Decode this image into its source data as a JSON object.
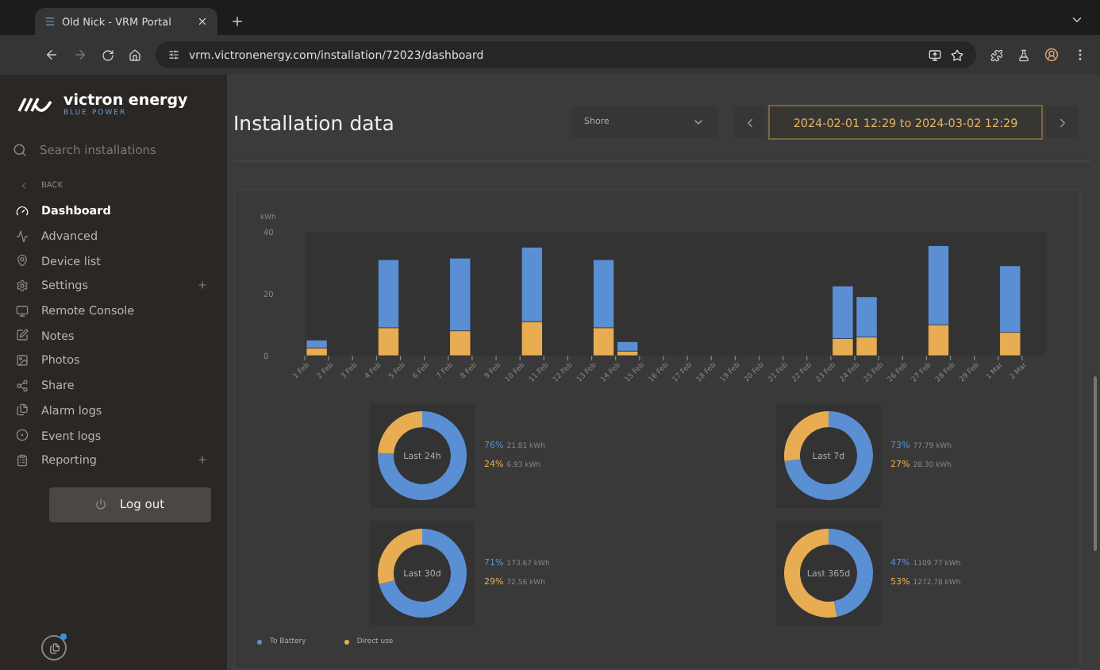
{
  "browser": {
    "tab_title": "Old Nick - VRM Portal",
    "url": "vrm.victronenergy.com/installation/72023/dashboard"
  },
  "sidebar": {
    "brand": "victron energy",
    "brand_tagline": "BLUE POWER",
    "search": {
      "placeholder": "Search installations"
    },
    "back": "BACK",
    "items": [
      {
        "label": "Dashboard",
        "selected": true,
        "expandable": false
      },
      {
        "label": "Advanced",
        "selected": false,
        "expandable": false
      },
      {
        "label": "Device list",
        "selected": false,
        "expandable": false
      },
      {
        "label": "Settings",
        "selected": false,
        "expandable": true
      },
      {
        "label": "Remote Console",
        "selected": false,
        "expandable": false
      },
      {
        "label": "Notes",
        "selected": false,
        "expandable": false
      },
      {
        "label": "Photos",
        "selected": false,
        "expandable": false
      },
      {
        "label": "Share",
        "selected": false,
        "expandable": false
      },
      {
        "label": "Alarm logs",
        "selected": false,
        "expandable": false
      },
      {
        "label": "Event logs",
        "selected": false,
        "expandable": false
      },
      {
        "label": "Reporting",
        "selected": false,
        "expandable": true
      }
    ],
    "logout": "Log out"
  },
  "header": {
    "title": "Installation data",
    "source": "Shore",
    "range": "2024-02-01 12:29 to 2024-03-02 12:29"
  },
  "chart_data": {
    "type": "bar",
    "stacked": true,
    "ylabel": "kWh",
    "ylim": [
      0,
      40
    ],
    "yticks": [
      0,
      20,
      40
    ],
    "categories": [
      "1 Feb",
      "2 Feb",
      "3 Feb",
      "4 Feb",
      "5 Feb",
      "6 Feb",
      "7 Feb",
      "8 Feb",
      "9 Feb",
      "10 Feb",
      "11 Feb",
      "12 Feb",
      "13 Feb",
      "14 Feb",
      "15 Feb",
      "16 Feb",
      "17 Feb",
      "18 Feb",
      "19 Feb",
      "20 Feb",
      "21 Feb",
      "22 Feb",
      "23 Feb",
      "24 Feb",
      "25 Feb",
      "26 Feb",
      "27 Feb",
      "28 Feb",
      "29 Feb",
      "1 Mar",
      "2 Mar"
    ],
    "series": [
      {
        "name": "To Battery",
        "color": "#5b8fd3",
        "values": [
          2.5,
          0,
          0,
          22,
          0,
          0,
          23.5,
          0,
          0,
          24,
          0,
          0,
          22,
          3,
          0,
          0,
          0,
          0,
          0,
          0,
          0,
          0,
          17,
          13,
          0,
          0,
          25.5,
          0,
          0,
          21.5,
          0
        ]
      },
      {
        "name": "Direct use",
        "color": "#e8ad52",
        "values": [
          2.5,
          0,
          0,
          9,
          0,
          0,
          8,
          0,
          0,
          11,
          0,
          0,
          9,
          1.5,
          0,
          0,
          0,
          0,
          0,
          0,
          0,
          0,
          5.5,
          6,
          0,
          0,
          10,
          0,
          0,
          7.5,
          0
        ]
      }
    ]
  },
  "donuts": [
    {
      "chart_data": {
        "type": "donut",
        "title": "Last 24h",
        "values": [
          76,
          24
        ]
      },
      "readings": [
        {
          "percent": "76%",
          "energy": "21.81 kWh"
        },
        {
          "percent": "24%",
          "energy": "6.93 kWh"
        }
      ]
    },
    {
      "chart_data": {
        "type": "donut",
        "title": "Last 7d",
        "values": [
          73,
          27
        ]
      },
      "readings": [
        {
          "percent": "73%",
          "energy": "77.79 kWh"
        },
        {
          "percent": "27%",
          "energy": "28.30 kWh"
        }
      ]
    },
    {
      "chart_data": {
        "type": "donut",
        "title": "Last 30d",
        "values": [
          71,
          29
        ]
      },
      "readings": [
        {
          "percent": "71%",
          "energy": "173.67 kWh"
        },
        {
          "percent": "29%",
          "energy": "72.56 kWh"
        }
      ]
    },
    {
      "chart_data": {
        "type": "donut",
        "title": "Last 365d",
        "values": [
          47,
          53
        ]
      },
      "readings": [
        {
          "percent": "47%",
          "energy": "1109.77 kWh"
        },
        {
          "percent": "53%",
          "energy": "1272.78 kWh"
        }
      ]
    }
  ]
}
